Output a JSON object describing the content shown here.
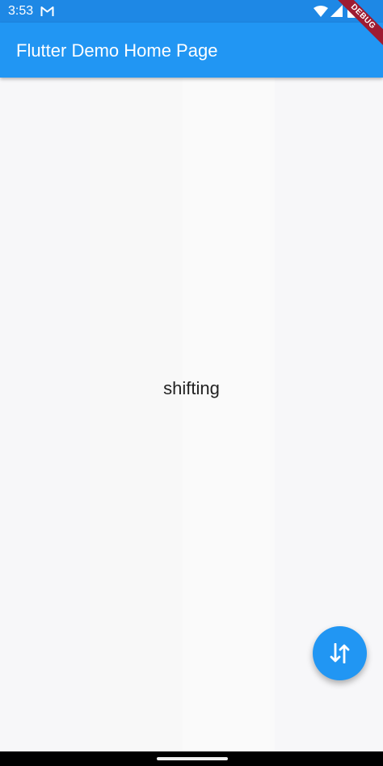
{
  "status_bar": {
    "time": "3:53",
    "icons": [
      "gmail-icon",
      "wifi-icon",
      "signal-icon",
      "battery-icon"
    ]
  },
  "app_bar": {
    "title": "Flutter Demo Home Page"
  },
  "debug_banner": {
    "label": "DEBUG"
  },
  "body": {
    "text": "shifting"
  },
  "fab": {
    "icon": "swap-vertical-icon"
  },
  "colors": {
    "primary": "#2196f3",
    "status_bar": "#1e88e5",
    "background": "#fafafa",
    "debug_banner": "#9e1b32"
  }
}
